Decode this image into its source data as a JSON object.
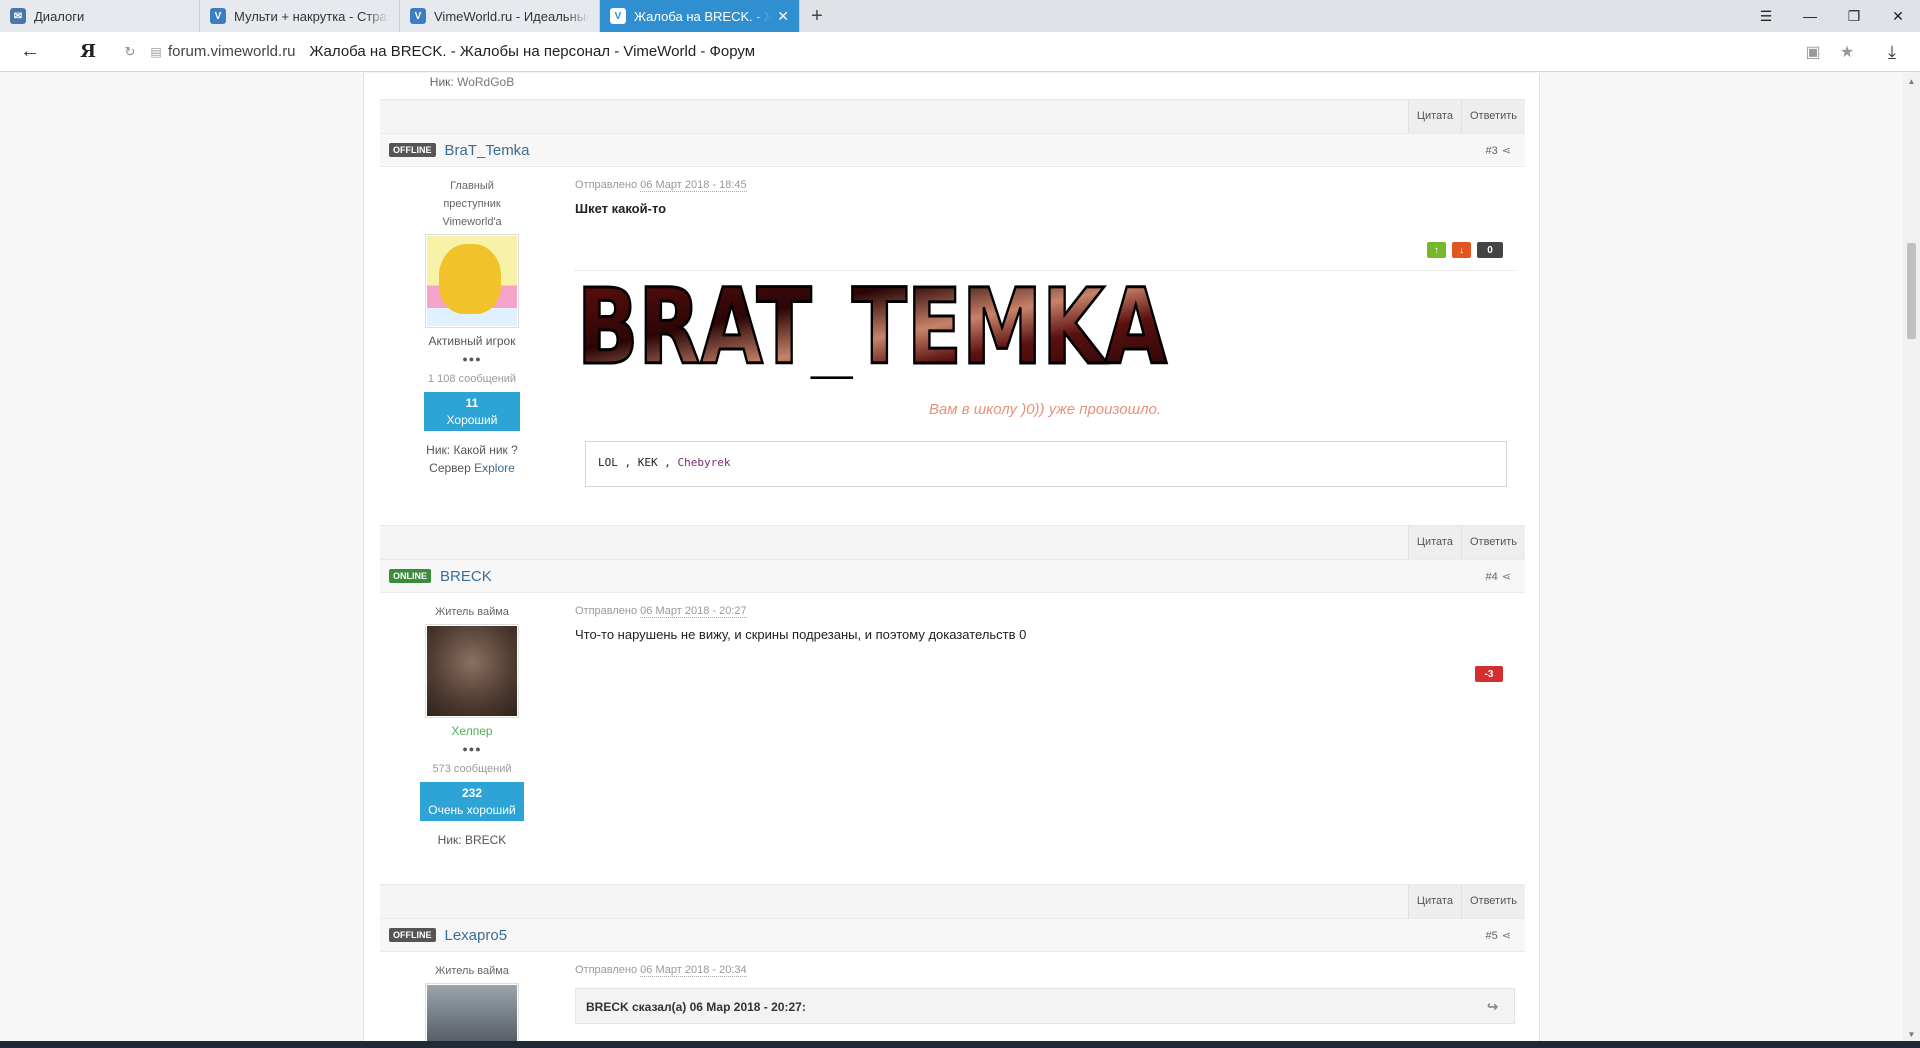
{
  "browser": {
    "tabs": [
      {
        "label": "Диалоги",
        "icon": "chat-icon",
        "active": false
      },
      {
        "label": "Мульти + накрутка - Страница",
        "icon": "vimeworld-icon",
        "active": false
      },
      {
        "label": "VimeWorld.ru - Идеальные",
        "icon": "vimeworld-icon",
        "active": false
      },
      {
        "label": "Жалоба на BRECK. - Жалобы",
        "icon": "vimeworld-icon",
        "active": true
      }
    ],
    "new_tab": "+",
    "back": "←",
    "yandex": "Я",
    "domain": "forum.vimeworld.ru",
    "page_title": "Жалоба на BRECK. - Жалобы на персонал - VimeWorld - Форум"
  },
  "prev_post": {
    "nick_label": "Ник:",
    "nick_value": "WoRdGoB"
  },
  "controls": {
    "quote": "Цитата",
    "reply": "Ответить"
  },
  "posts": [
    {
      "status": "OFFLINE",
      "name": "BraT_Temka",
      "num": "#3",
      "rank": "Главный преступник Vimeworld'а",
      "group": "Активный игрок",
      "pips": "●●●",
      "posts_count": "1 108 сообщений",
      "rep_value": "11",
      "rep_label": "Хороший",
      "nick_label": "Ник:",
      "nick_value": "Какой ник ?",
      "server_label": "Сервер",
      "server_value": "Explore",
      "posted_label": "Отправлено",
      "posted_date": "06 Март 2018 - 18:45",
      "text": "Шкет какой-то",
      "rating": "0",
      "sig_logo": "BRAT_TEMKA",
      "sig_school": "Вам в школу )0))  уже произошло.",
      "code": {
        "w1": "LOL",
        "w2": "KEK",
        "w3": "Chebyrek",
        "sep": ","
      }
    },
    {
      "status": "ONLINE",
      "name": "BRECK",
      "num": "#4",
      "rank": "Житель вайма",
      "group": "Хелпер",
      "pips": "●●●",
      "posts_count": "573 сообщений",
      "rep_value": "232",
      "rep_label": "Очень хороший",
      "nick_label": "Ник:",
      "nick_value": "BRECK",
      "posted_label": "Отправлено",
      "posted_date": "06 Март 2018 - 20:27",
      "text": "Что-то нарушень не вижу, и скрины подрезаны, и поэтому доказательств 0",
      "rating": "-3"
    },
    {
      "status": "OFFLINE",
      "name": "Lexapro5",
      "num": "#5",
      "rank": "Житель вайма",
      "posted_label": "Отправлено",
      "posted_date": "06 Март 2018 - 20:34",
      "quote_header": "BRECK сказал(а) 06 Мар 2018 - 20:27:"
    }
  ],
  "colors": {
    "accent": "#2f8fd1",
    "rep_blue": "#2ea3d6",
    "online": "#3d8b3d",
    "offline": "#555555",
    "negative": "#d32f2f"
  }
}
